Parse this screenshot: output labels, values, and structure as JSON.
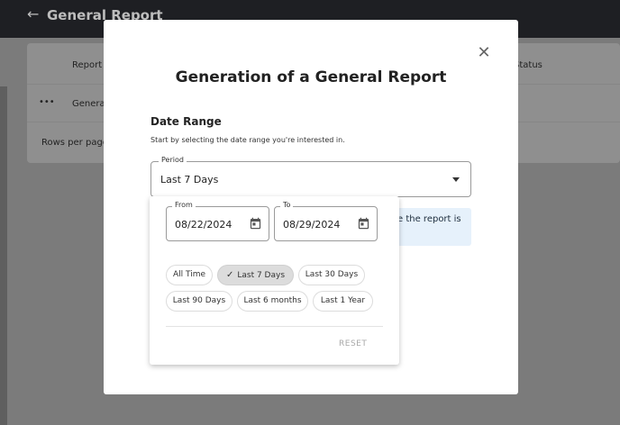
{
  "background": {
    "page_title": "General Report",
    "table": {
      "header_report": "Report",
      "header_status": "Status",
      "row_actions": "•••",
      "row_name": "General",
      "footer": "Rows per page"
    }
  },
  "modal": {
    "title": "Generation of a General Report",
    "section_title": "Date Range",
    "section_subtitle": "Start by selecting the date range you're interested in.",
    "period": {
      "label": "Period",
      "value": "Last 7 Days"
    },
    "info_text": "e the report is"
  },
  "picker": {
    "from": {
      "label": "From",
      "value": "08/22/2024"
    },
    "to": {
      "label": "To",
      "value": "08/29/2024"
    },
    "chips": [
      {
        "label": "All Time",
        "selected": false
      },
      {
        "label": "Last 7 Days",
        "selected": true
      },
      {
        "label": "Last 30 Days",
        "selected": false
      },
      {
        "label": "Last 90 Days",
        "selected": false
      },
      {
        "label": "Last 6 months",
        "selected": false
      },
      {
        "label": "Last 1 Year",
        "selected": false
      }
    ],
    "reset_label": "RESET"
  },
  "icons": {
    "back": "arrow-left-icon",
    "close": "close-icon",
    "caret": "caret-down-icon",
    "calendar": "calendar-icon",
    "check": "check-icon"
  },
  "colors": {
    "overlay": "#7e7e7e",
    "topbar": "#1e1f23",
    "info_bg": "#e6f1fb",
    "chip_selected": "#dcdcdc",
    "reset_text": "#a8a8a8"
  }
}
